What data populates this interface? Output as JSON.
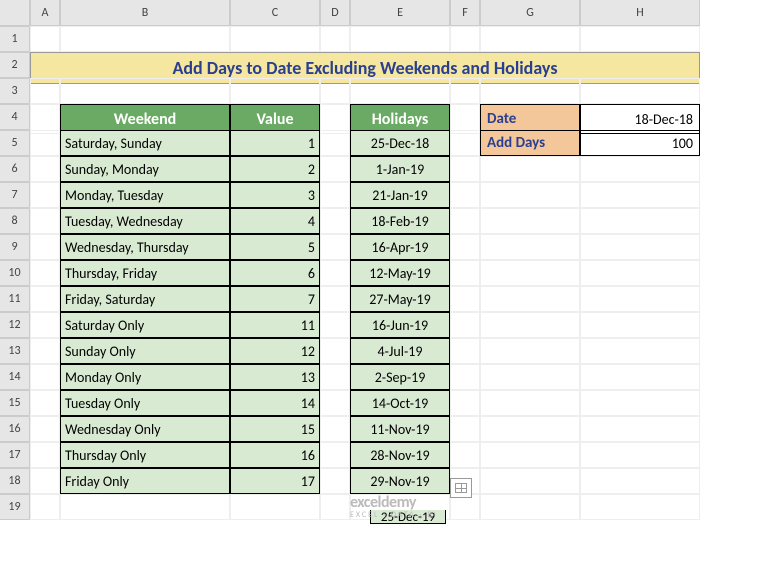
{
  "columns": [
    "A",
    "B",
    "C",
    "D",
    "E",
    "F",
    "G",
    "H"
  ],
  "row_count": 19,
  "title": "Add Days to Date Excluding Weekends and Holidays",
  "weekend_header": {
    "col1": "Weekend",
    "col2": "Value"
  },
  "weekend_rows": [
    {
      "name": "Saturday, Sunday",
      "value": "1"
    },
    {
      "name": "Sunday, Monday",
      "value": "2"
    },
    {
      "name": "Monday, Tuesday",
      "value": "3"
    },
    {
      "name": "Tuesday, Wednesday",
      "value": "4"
    },
    {
      "name": "Wednesday, Thursday",
      "value": "5"
    },
    {
      "name": "Thursday, Friday",
      "value": "6"
    },
    {
      "name": "Friday, Saturday",
      "value": "7"
    },
    {
      "name": "Saturday Only",
      "value": "11"
    },
    {
      "name": "Sunday Only",
      "value": "12"
    },
    {
      "name": "Monday Only",
      "value": "13"
    },
    {
      "name": "Tuesday Only",
      "value": "14"
    },
    {
      "name": "Wednesday Only",
      "value": "15"
    },
    {
      "name": "Thursday Only",
      "value": "16"
    },
    {
      "name": "Friday Only",
      "value": "17"
    }
  ],
  "holidays_header": "Holidays",
  "holidays": [
    "25-Dec-18",
    "1-Jan-19",
    "21-Jan-19",
    "18-Feb-19",
    "16-Apr-19",
    "12-May-19",
    "27-May-19",
    "16-Jun-19",
    "4-Jul-19",
    "2-Sep-19",
    "14-Oct-19",
    "11-Nov-19",
    "28-Nov-19",
    "29-Nov-19"
  ],
  "holidays_overflow": "25-Dec-19",
  "params": {
    "date_label": "Date",
    "date_value": "18-Dec-18",
    "adddays_label": "Add Days",
    "adddays_value": "100"
  },
  "watermark": {
    "brand": "exceldemy",
    "tag": "EXCEL · DATA · BI"
  }
}
